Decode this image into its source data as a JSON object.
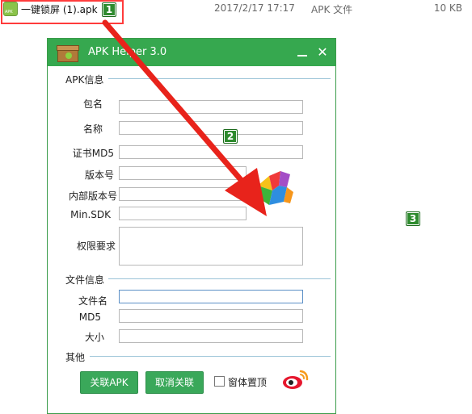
{
  "file_row": {
    "icon_text": "APK",
    "name": "一键锁屏 (1).apk",
    "date": "2017/2/17 17:17",
    "type": "APK 文件",
    "size": "10 KB"
  },
  "badges": [
    "1",
    "2",
    "3"
  ],
  "window": {
    "title": "APK Helper 3.0",
    "close_glyph": "✕"
  },
  "apk_info": {
    "section_label": "APK信息",
    "fields": [
      {
        "label": "包名",
        "value": ""
      },
      {
        "label": "名称",
        "value": ""
      },
      {
        "label": "证书MD5",
        "value": ""
      },
      {
        "label": "版本号",
        "value": ""
      },
      {
        "label": "内部版本号",
        "value": ""
      },
      {
        "label": "Min.SDK",
        "value": ""
      },
      {
        "label": "权限要求",
        "value": ""
      }
    ]
  },
  "file_info": {
    "section_label": "文件信息",
    "fields": [
      {
        "label": "文件名",
        "value": ""
      },
      {
        "label": "MD5",
        "value": ""
      },
      {
        "label": "大小",
        "value": ""
      }
    ]
  },
  "other": {
    "section_label": "其他",
    "associate_button": "关联APK",
    "unassociate_button": "取消关联",
    "topmost_label": "窗体置顶"
  },
  "icons": {
    "app": "treasure-chest-icon",
    "logo": "360-logo-icon",
    "weibo": "weibo-icon",
    "file": "apk-file-icon"
  },
  "colors": {
    "accent_green": "#36a84f",
    "button_green": "#3aa85a",
    "arrow_red": "#e8231b",
    "badge_green": "#2e8b2e"
  }
}
